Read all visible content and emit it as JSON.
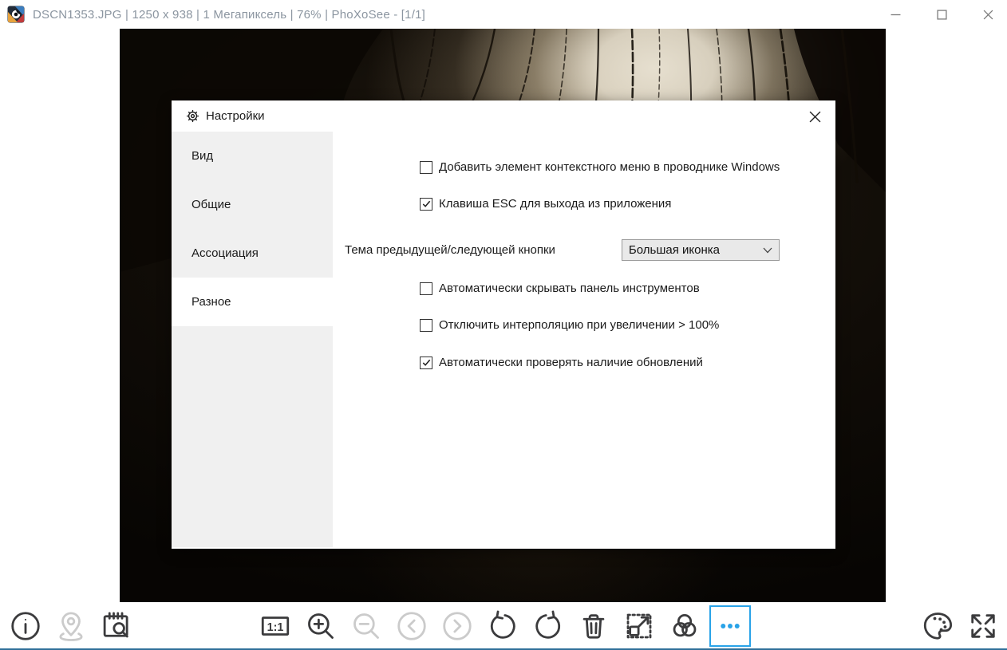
{
  "window": {
    "title": "DSCN1353.JPG  |  1250 x 938  |  1 Мегапиксель  |  76%  |  PhoXoSee  -  [1/1]",
    "filename": "DSCN1353.JPG",
    "dimensions": "1250 x 938",
    "megapixels": "1 Мегапиксель",
    "zoom_level": "76%",
    "app_name": "PhoXoSee",
    "page_indicator": "[1/1]",
    "controls": [
      "minimize",
      "maximize",
      "close"
    ]
  },
  "dialog": {
    "title": "Настройки",
    "close_icon": "close",
    "tabs": [
      {
        "label": "Вид",
        "selected": false
      },
      {
        "label": "Общие",
        "selected": false
      },
      {
        "label": "Ассоциация",
        "selected": false
      },
      {
        "label": "Разное",
        "selected": true
      }
    ],
    "options": [
      {
        "type": "checkbox",
        "label": "Добавить элемент контекстного меню в проводнике Windows",
        "checked": false
      },
      {
        "type": "checkbox",
        "label": "Клавиша ESC для выхода из приложения",
        "checked": true
      },
      {
        "type": "select",
        "label": "Тема предыдущей/следующей кнопки",
        "value": "Большая иконка"
      },
      {
        "type": "checkbox",
        "label": "Автоматически скрывать панель инструментов",
        "checked": false
      },
      {
        "type": "checkbox",
        "label": "Отключить интерполяцию при увеличении > 100%",
        "checked": false
      },
      {
        "type": "checkbox",
        "label": "Автоматически проверять наличие обновлений",
        "checked": true
      }
    ]
  },
  "toolbar": {
    "icons": [
      {
        "name": "info",
        "state": "normal"
      },
      {
        "name": "geolocation",
        "state": "disabled"
      },
      {
        "name": "exif-search",
        "state": "normal"
      },
      {
        "name": "actual-size-1:1",
        "state": "normal"
      },
      {
        "name": "zoom-in",
        "state": "normal"
      },
      {
        "name": "zoom-out",
        "state": "disabled"
      },
      {
        "name": "previous",
        "state": "disabled"
      },
      {
        "name": "next",
        "state": "disabled"
      },
      {
        "name": "rotate-left",
        "state": "normal"
      },
      {
        "name": "rotate-right",
        "state": "normal"
      },
      {
        "name": "delete",
        "state": "normal"
      },
      {
        "name": "resize",
        "state": "normal"
      },
      {
        "name": "color-adjust",
        "state": "normal"
      },
      {
        "name": "more",
        "state": "active"
      },
      {
        "name": "palette",
        "state": "normal"
      },
      {
        "name": "fullscreen",
        "state": "normal"
      }
    ]
  },
  "colors": {
    "accent_blue": "#29a3e8",
    "titlebar_text": "#8b95a0",
    "bottom_border": "#2f6f99",
    "sidebar_gray": "#f0f0f0"
  }
}
